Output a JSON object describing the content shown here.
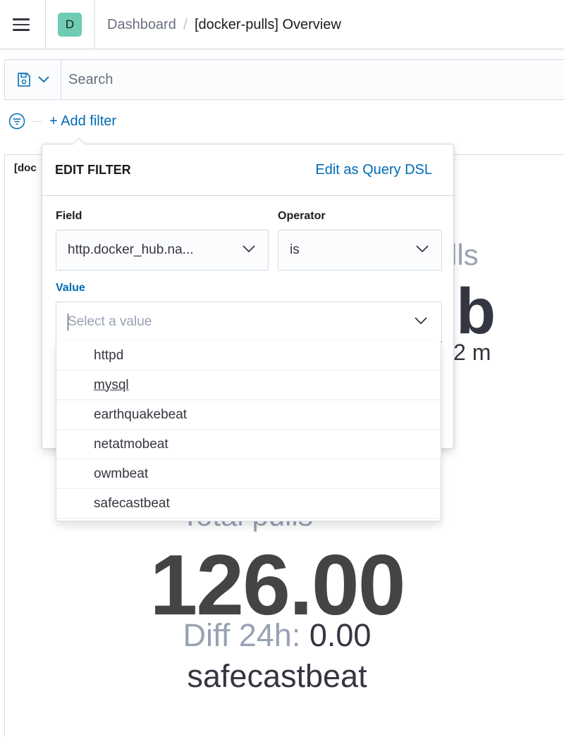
{
  "header": {
    "space_initial": "D",
    "breadcrumb_parent": "Dashboard",
    "breadcrumb_separator": "/",
    "breadcrumb_current": "[docker-pulls] Overview"
  },
  "querybar": {
    "search_placeholder": "Search"
  },
  "filters": {
    "add_filter_label": "+ Add filter"
  },
  "panel": {
    "title": "[doc",
    "bg_label_fragment": "lls",
    "bg_value_fragment": "b",
    "bg_time_fragment": "2 m",
    "metric_label": "Total pulls",
    "metric_value": "126.00",
    "diff_label": "Diff 24h:",
    "diff_value": "0.00",
    "metric_name": "safecastbeat"
  },
  "edit_filter": {
    "title": "EDIT FILTER",
    "query_dsl_link": "Edit as Query DSL",
    "field_label": "Field",
    "field_value": "http.docker_hub.na...",
    "operator_label": "Operator",
    "operator_value": "is",
    "value_label": "Value",
    "value_placeholder": "Select a value",
    "options": [
      "httpd",
      "mysql",
      "earthquakebeat",
      "netatmobeat",
      "owmbeat",
      "safecastbeat"
    ]
  },
  "colors": {
    "accent": "#006bb4",
    "avatar": "#6dccb1",
    "border": "#d3dae6",
    "muted": "#98a2b3"
  }
}
